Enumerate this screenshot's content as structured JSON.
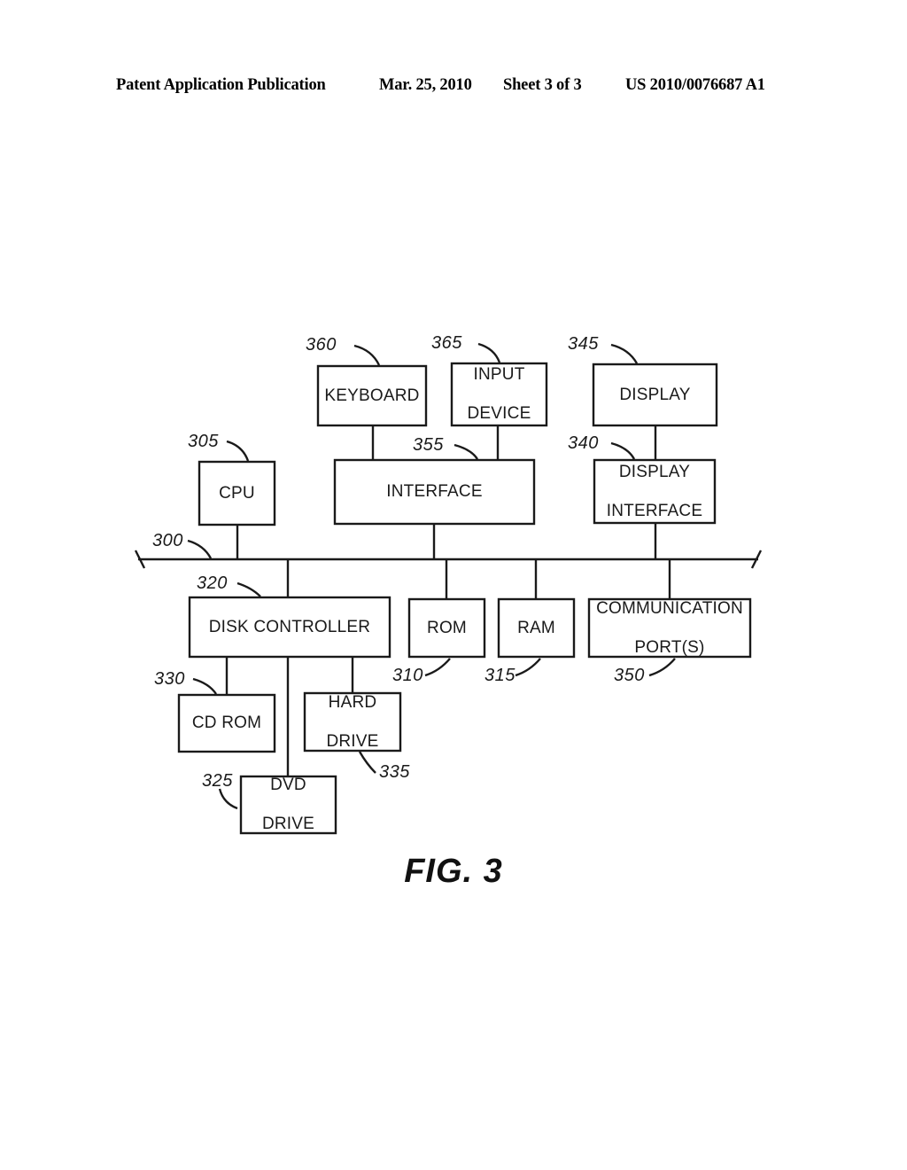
{
  "header": {
    "left": "Patent Application Publication",
    "date": "Mar. 25, 2010",
    "sheet": "Sheet 3 of 3",
    "patent_number": "US 2010/0076687 A1"
  },
  "figure": {
    "caption": "FIG. 3",
    "line_color": "#1a1a1a"
  },
  "blocks": [
    {
      "id": "keyboard",
      "label": "KEYBOARD",
      "ref": "360"
    },
    {
      "id": "input-device",
      "label": "INPUT\nDEVICE",
      "ref": "365"
    },
    {
      "id": "display",
      "label": "DISPLAY",
      "ref": "345"
    },
    {
      "id": "cpu",
      "label": "CPU",
      "ref": "305"
    },
    {
      "id": "interface",
      "label": "INTERFACE",
      "ref": "355"
    },
    {
      "id": "display-interface",
      "label": "DISPLAY\nINTERFACE",
      "ref": "340"
    },
    {
      "id": "bus",
      "label": "",
      "ref": "300"
    },
    {
      "id": "disk-controller",
      "label": "DISK CONTROLLER",
      "ref": "320"
    },
    {
      "id": "rom",
      "label": "ROM",
      "ref": "310"
    },
    {
      "id": "ram",
      "label": "RAM",
      "ref": "315"
    },
    {
      "id": "communication-port",
      "label": "COMMUNICATION\nPORT(S)",
      "ref": "350"
    },
    {
      "id": "cd-rom",
      "label": "CD ROM",
      "ref": "330"
    },
    {
      "id": "hard-drive",
      "label": "HARD\nDRIVE",
      "ref": "335"
    },
    {
      "id": "dvd-drive",
      "label": "DVD\nDRIVE",
      "ref": "325"
    }
  ],
  "labels": {
    "keyboard": "KEYBOARD",
    "input_device_line1": "INPUT",
    "input_device_line2": "DEVICE",
    "display": "DISPLAY",
    "cpu": "CPU",
    "interface": "INTERFACE",
    "display_interface_line1": "DISPLAY",
    "display_interface_line2": "INTERFACE",
    "disk_controller": "DISK CONTROLLER",
    "rom": "ROM",
    "ram": "RAM",
    "comm_port_line1": "COMMUNICATION",
    "comm_port_line2": "PORT(S)",
    "cd_rom": "CD ROM",
    "hard_drive_line1": "HARD",
    "hard_drive_line2": "DRIVE",
    "dvd_drive_line1": "DVD",
    "dvd_drive_line2": "DRIVE"
  },
  "refs": {
    "keyboard": "360",
    "input_device": "365",
    "display": "345",
    "cpu": "305",
    "interface": "355",
    "display_interface": "340",
    "bus": "300",
    "disk_controller": "320",
    "rom": "310",
    "ram": "315",
    "comm_port": "350",
    "cd_rom": "330",
    "hard_drive": "335",
    "dvd_drive": "325"
  }
}
